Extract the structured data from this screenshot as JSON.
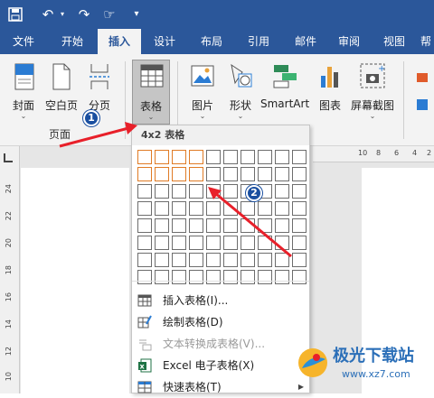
{
  "tabs": [
    "文件",
    "开始",
    "插入",
    "设计",
    "布局",
    "引用",
    "邮件",
    "审阅",
    "视图"
  ],
  "ribbon": {
    "cover": "封面",
    "blank_page": "空白页",
    "page_break": "分页",
    "table": "表格",
    "picture": "图片",
    "shapes": "形状",
    "smartart": "SmartArt",
    "chart": "图表",
    "screenshot": "屏幕截图",
    "group_pages": "页面",
    "dropdown": "⌄"
  },
  "table_menu": {
    "header": "4x2 表格",
    "grid_cols": 10,
    "grid_rows": 8,
    "selected_cols": 4,
    "selected_rows": 2,
    "items": [
      {
        "label": "插入表格(I)...",
        "icon": "insert-table-icon",
        "enabled": true
      },
      {
        "label": "绘制表格(D)",
        "icon": "draw-table-icon",
        "enabled": true
      },
      {
        "label": "文本转换成表格(V)...",
        "icon": "convert-text-icon",
        "enabled": false
      },
      {
        "label": "Excel 电子表格(X)",
        "icon": "excel-icon",
        "enabled": true
      },
      {
        "label": "快速表格(T)",
        "icon": "quick-table-icon",
        "enabled": true
      }
    ]
  },
  "ruler": {
    "vertical_ticks": [
      "24",
      "22",
      "20",
      "18",
      "16",
      "14",
      "12",
      "10"
    ],
    "horizontal_ticks": [
      "10",
      "8",
      "6",
      "4",
      "2"
    ]
  },
  "annotations": {
    "step1": "1",
    "step2": "2"
  },
  "watermark": {
    "text": "极光下载站",
    "url": "www.xz7.com"
  },
  "colors": {
    "accent": "#2b579a",
    "selection": "#e07b25",
    "arrow": "#e8202a"
  }
}
